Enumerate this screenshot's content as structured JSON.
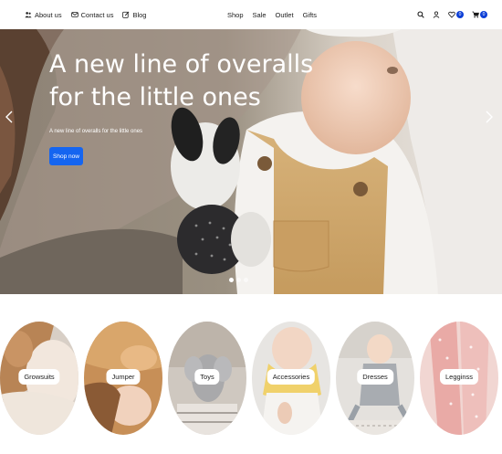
{
  "header": {
    "left_links": [
      {
        "label": "About us",
        "icon": "users-icon"
      },
      {
        "label": "Contact us",
        "icon": "envelope-icon"
      },
      {
        "label": "Blog",
        "icon": "edit-icon"
      }
    ],
    "center_links": [
      "Shop",
      "Sale",
      "Outlet",
      "Gifts"
    ],
    "wishlist_count": "0",
    "cart_count": "0"
  },
  "hero": {
    "title": "A new line of overalls for the little ones",
    "subtitle": "A new line of overalls for the little ones",
    "button_label": "Shop now",
    "slide_count": 3,
    "active_slide": 1,
    "button_color": "#1565f0"
  },
  "categories": [
    {
      "label": "Growsuits"
    },
    {
      "label": "Jumper"
    },
    {
      "label": "Toys"
    },
    {
      "label": "Accessories"
    },
    {
      "label": "Dresses"
    },
    {
      "label": "Legginss"
    }
  ],
  "colors": {
    "accent": "#0d3fd6"
  }
}
